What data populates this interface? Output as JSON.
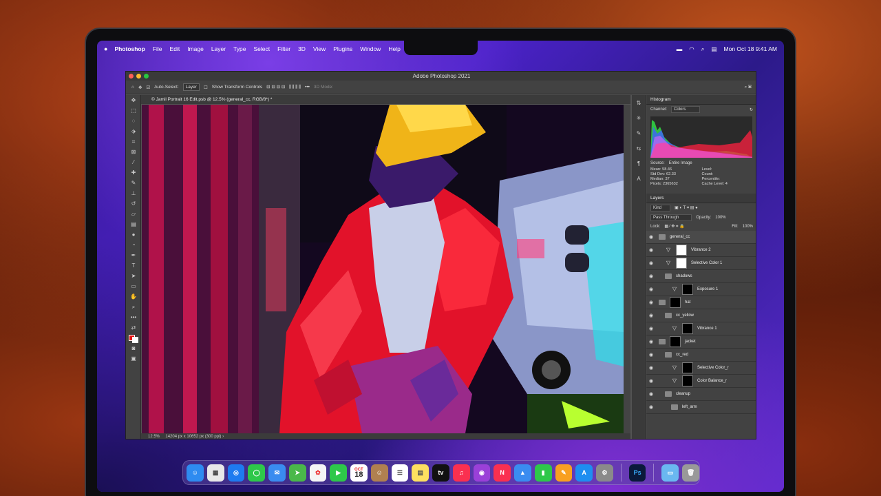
{
  "menubar": {
    "app_name": "Photoshop",
    "items": [
      "File",
      "Edit",
      "Image",
      "Layer",
      "Type",
      "Select",
      "Filter",
      "3D",
      "View",
      "Plugins",
      "Window",
      "Help"
    ],
    "clock": "Mon Oct 18  9:41 AM"
  },
  "window": {
    "title": "Adobe Photoshop 2021",
    "doc_tab": "© Jamil Portrait 16 Edit.psb @ 12.5% (general_cc, RGB/8*) *",
    "status_zoom": "12.5%",
    "status_info": "14204 px x 10652 px (300 ppi)"
  },
  "options": {
    "auto_select_label": "Auto-Select:",
    "auto_select_value": "Layer",
    "show_transform": "Show Transform Controls",
    "mode_3d": "3D Mode:"
  },
  "histogram": {
    "title": "Histogram",
    "channel_label": "Channel:",
    "channel_value": "Colors",
    "source_label": "Source:",
    "source_value": "Entire Image",
    "mean": "Mean: 58.46",
    "std_dev": "Std Dev: 62.33",
    "median": "Median: 37",
    "pixels": "Pixels: 2365632",
    "level": "Level:",
    "count": "Count:",
    "percentile": "Percentile:",
    "cache": "Cache Level: 4"
  },
  "layers": {
    "title": "Layers",
    "kind": "Kind",
    "blend": "Pass Through",
    "opacity_label": "Opacity:",
    "opacity": "100%",
    "lock_label": "Lock:",
    "fill_label": "Fill:",
    "fill": "100%",
    "rows": [
      {
        "name": "general_cc",
        "type": "group",
        "indent": 0
      },
      {
        "name": "Vibrance 2",
        "type": "adjust",
        "indent": 1,
        "thumb": "white"
      },
      {
        "name": "Selective Color 1",
        "type": "adjust",
        "indent": 1,
        "thumb": "white"
      },
      {
        "name": "shadows",
        "type": "group",
        "indent": 1
      },
      {
        "name": "Exposure 1",
        "type": "adjust",
        "indent": 2,
        "thumb": "black"
      },
      {
        "name": "hat",
        "type": "group",
        "indent": 0,
        "thumb": "black"
      },
      {
        "name": "cc_yellow",
        "type": "group",
        "indent": 1
      },
      {
        "name": "Vibrance 1",
        "type": "adjust",
        "indent": 2,
        "thumb": "black"
      },
      {
        "name": "jacket",
        "type": "group",
        "indent": 0,
        "thumb": "black"
      },
      {
        "name": "cc_red",
        "type": "group",
        "indent": 1
      },
      {
        "name": "Selective Color_r",
        "type": "adjust",
        "indent": 2,
        "thumb": "black"
      },
      {
        "name": "Color Balance_r",
        "type": "adjust",
        "indent": 2,
        "thumb": "black"
      },
      {
        "name": "cleanup",
        "type": "group",
        "indent": 1
      },
      {
        "name": "left_arm",
        "type": "group",
        "indent": 2
      }
    ]
  },
  "dock": {
    "calendar_month": "OCT",
    "calendar_day": "18",
    "tv_label": "tv",
    "ps_label": "Ps"
  }
}
